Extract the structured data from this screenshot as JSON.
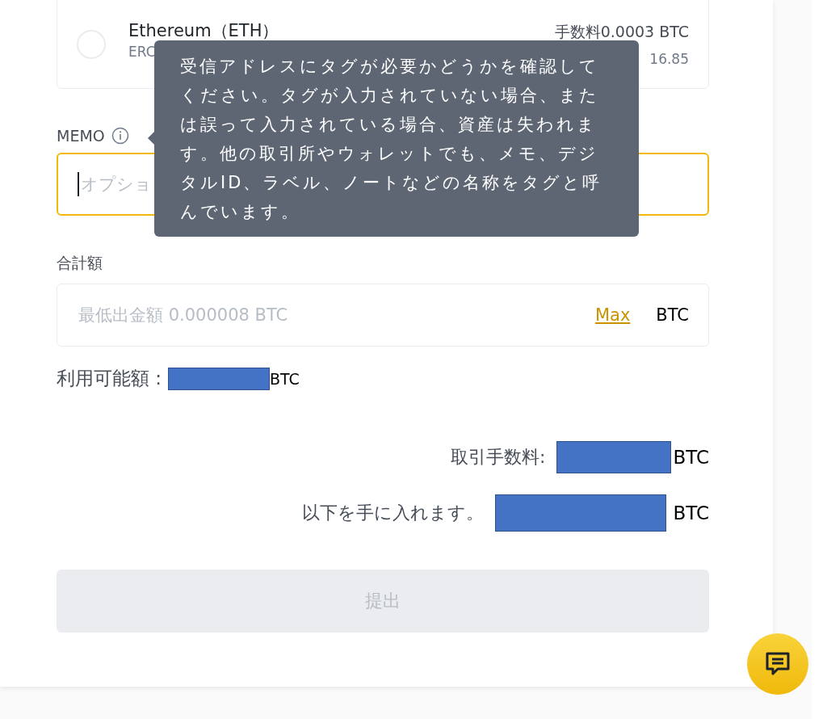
{
  "network_option": {
    "selected": false,
    "name": "Ethereum（ETH）",
    "protocol": "ERC",
    "fee": "手数料0.0003 BTC",
    "fee_value": "16.85"
  },
  "memo": {
    "label": "MEMO",
    "placeholder": "オプショ",
    "focused": true
  },
  "tooltip": {
    "text": "受信アドレスにタグが必要かどうかを確認してください。タグが入力されていない場合、または誤って入力されている場合、資産は失われます。他の取引所やウォレットでも、メモ、デジタルID、ラベル、ノートなどの名称をタグと呼んでいます。"
  },
  "amount": {
    "label": "合計額",
    "placeholder": "最低出金額 0.000008 BTC",
    "max_link": "Max",
    "unit": "BTC"
  },
  "available": {
    "label": "利用可能額 :",
    "unit": "BTC"
  },
  "summary": [
    {
      "label": "取引手数料:",
      "unit": "BTC"
    },
    {
      "label": "以下を手に入れます。",
      "unit": "BTC"
    }
  ],
  "submit": {
    "label": "提出",
    "disabled": true
  }
}
